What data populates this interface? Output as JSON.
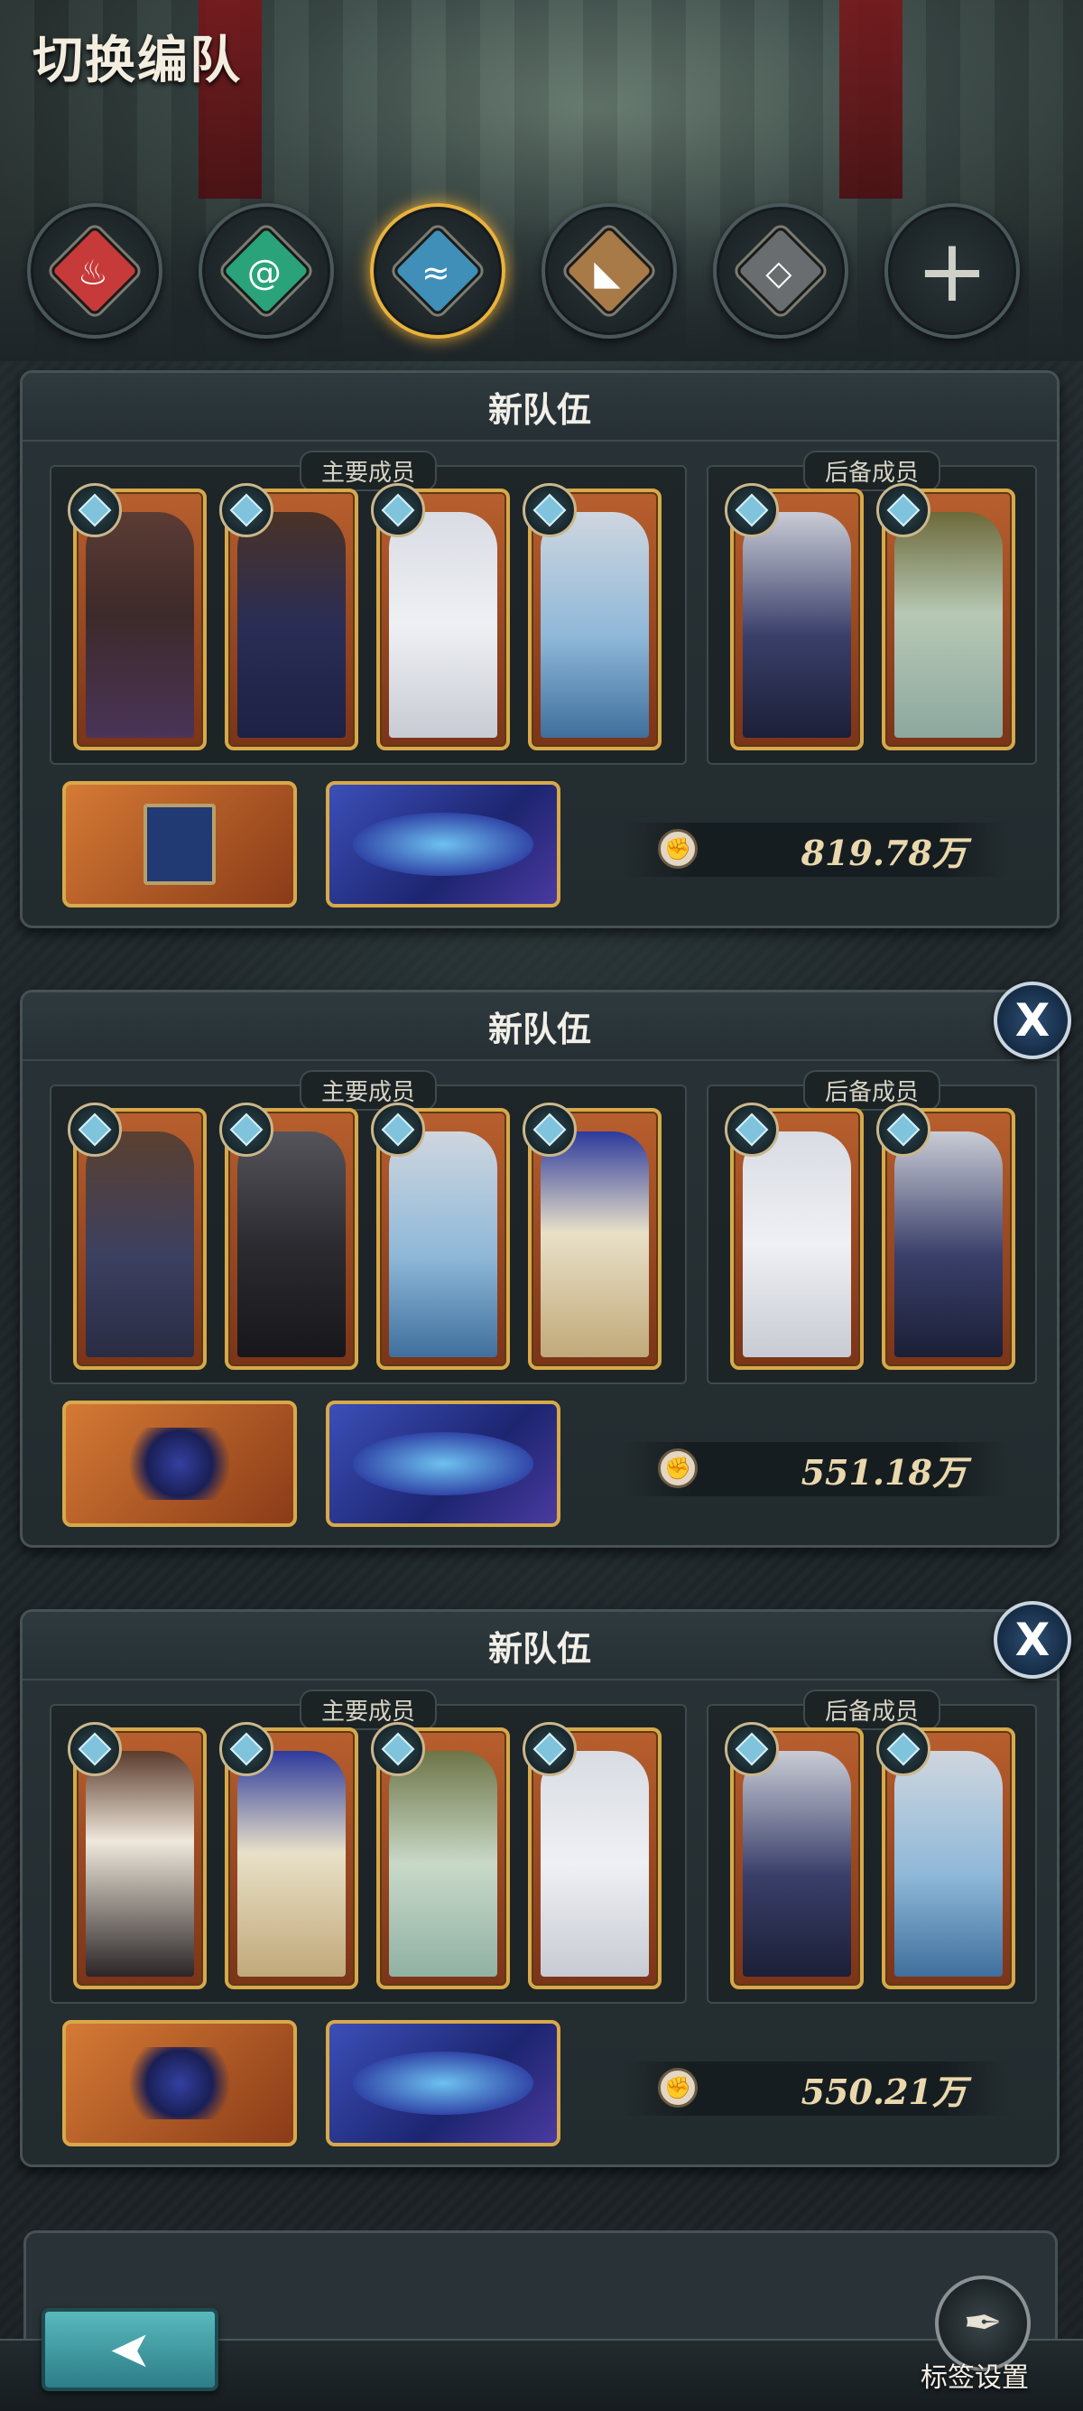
{
  "title": "切换编队",
  "element_tabs": [
    {
      "icon": "fire-element-icon",
      "color": "#c73a3a",
      "glyph": "♨",
      "active": false
    },
    {
      "icon": "wind-element-icon",
      "color": "#2aa37a",
      "glyph": "@",
      "active": false
    },
    {
      "icon": "water-element-icon",
      "color": "#3f8fb8",
      "glyph": "≈",
      "active": true
    },
    {
      "icon": "earth-element-icon",
      "color": "#a77a48",
      "glyph": "◣",
      "active": false
    },
    {
      "icon": "neutral-element-icon",
      "color": "#6a6d70",
      "glyph": "◇",
      "active": false
    },
    {
      "icon": "add-icon",
      "glyph": "+",
      "active": false
    }
  ],
  "teams": [
    {
      "name": "新队伍",
      "main_label": "主要成员",
      "reserve_label": "后备成员",
      "power": "819.78万",
      "closable": false
    },
    {
      "name": "新队伍",
      "main_label": "主要成员",
      "reserve_label": "后备成员",
      "power": "551.18万",
      "closable": true,
      "close_label": "X"
    },
    {
      "name": "新队伍",
      "main_label": "主要成员",
      "reserve_label": "后备成员",
      "power": "550.21万",
      "closable": true,
      "close_label": "X"
    }
  ],
  "footer": {
    "back_glyph": "➤",
    "tag_settings_label": "标签设置",
    "quill_glyph": "✒"
  },
  "power_glyph": "✊"
}
